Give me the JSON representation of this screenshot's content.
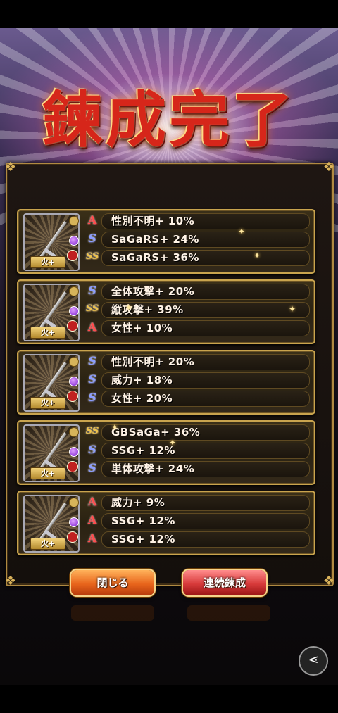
{
  "title": "鍊成完了",
  "cards": [
    {
      "weapon_badge": "火+",
      "skills": [
        {
          "rank": "A",
          "rank_icon": "A",
          "text": "性別不明+ 10%"
        },
        {
          "rank": "S",
          "rank_icon": "S",
          "text": "SaGaRS+ 24%"
        },
        {
          "rank": "SS",
          "rank_icon": "SS",
          "text": "SaGaRS+ 36%"
        }
      ]
    },
    {
      "weapon_badge": "火+",
      "skills": [
        {
          "rank": "S",
          "rank_icon": "S",
          "text": "全体攻撃+ 20%"
        },
        {
          "rank": "SS",
          "rank_icon": "SS",
          "text": "縦攻撃+ 39%"
        },
        {
          "rank": "A",
          "rank_icon": "A",
          "text": "女性+ 10%"
        }
      ]
    },
    {
      "weapon_badge": "火+",
      "skills": [
        {
          "rank": "S",
          "rank_icon": "S",
          "text": "性別不明+ 20%"
        },
        {
          "rank": "S",
          "rank_icon": "S",
          "text": "威力+ 18%"
        },
        {
          "rank": "S",
          "rank_icon": "S",
          "text": "女性+ 20%"
        }
      ]
    },
    {
      "weapon_badge": "火+",
      "skills": [
        {
          "rank": "SS",
          "rank_icon": "SS",
          "text": "GBSaGa+ 36%"
        },
        {
          "rank": "S",
          "rank_icon": "S",
          "text": "SSG+ 12%"
        },
        {
          "rank": "S",
          "rank_icon": "S",
          "text": "単体攻撃+ 24%"
        }
      ]
    },
    {
      "weapon_badge": "火+",
      "skills": [
        {
          "rank": "A",
          "rank_icon": "A",
          "text": "威力+ 9%"
        },
        {
          "rank": "A",
          "rank_icon": "A",
          "text": "SSG+ 12%"
        },
        {
          "rank": "A",
          "rank_icon": "A",
          "text": "SSG+ 12%"
        }
      ]
    }
  ],
  "buttons": {
    "close_label": "閉じる",
    "continue_label": "連続鍊成"
  },
  "icons": {
    "share": "share-icon",
    "weapon": "sword-icon"
  },
  "colors": {
    "rank_A": "#ff4c4c",
    "rank_S": "#8b9dff",
    "rank_SS": "#f0c34a",
    "frame_gold": "#c9a44e"
  }
}
